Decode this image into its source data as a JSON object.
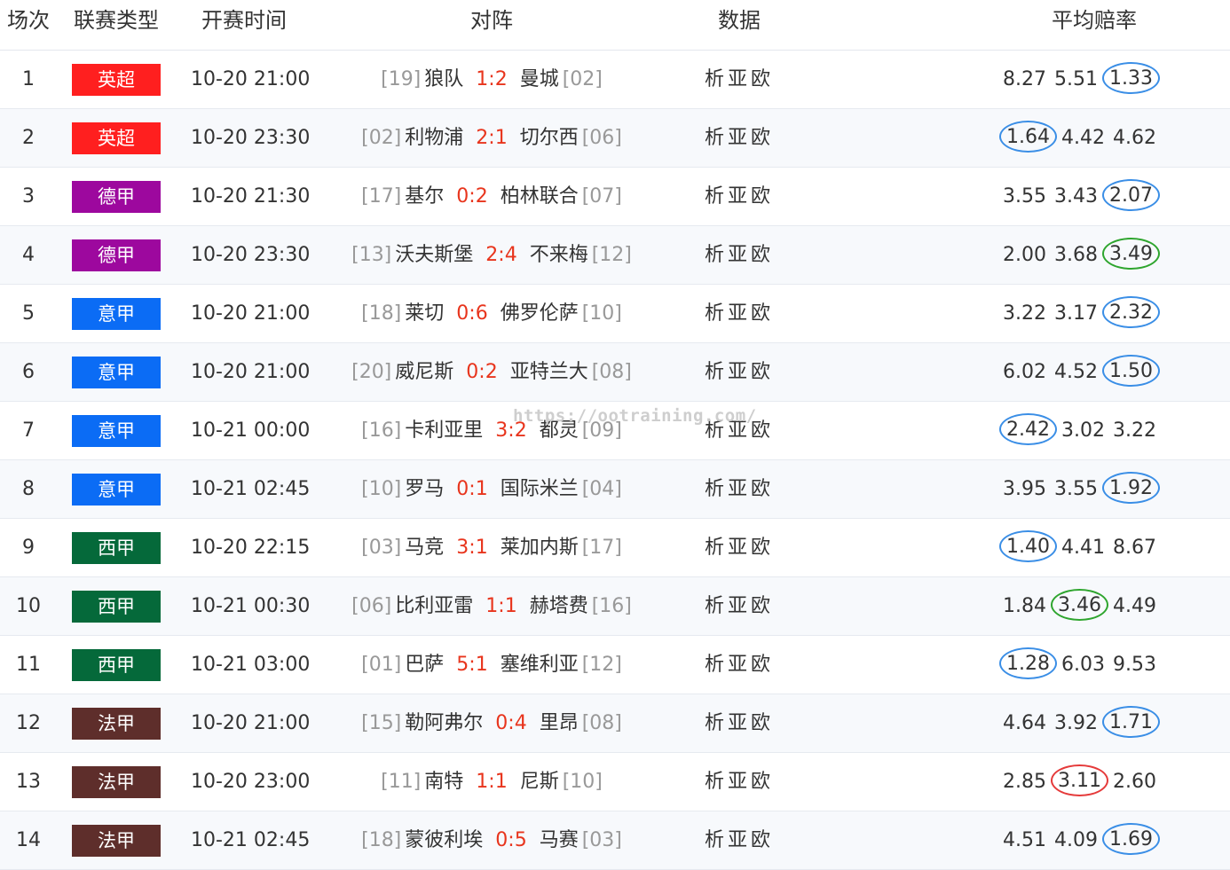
{
  "header": {
    "col_num": "场次",
    "col_league": "联赛类型",
    "col_time": "开赛时间",
    "col_match": "对阵",
    "col_data": "数据",
    "col_odds": "平均赔率"
  },
  "colors": {
    "premier_league": "#ff1f1f",
    "bundesliga": "#9d089e",
    "serie_a": "#0b6cf5",
    "la_liga": "#05693a",
    "ligue_1": "#5e2e2b",
    "score_red": "#e8351d",
    "circle_blue": "#3a8ee6",
    "circle_green": "#2ea52e",
    "circle_red": "#e53a3a"
  },
  "data_links": [
    "析",
    "亚",
    "欧"
  ],
  "watermark": "https://ootraining.com/",
  "rows": [
    {
      "num": "1",
      "league": "英超",
      "league_color": "#ff1f1f",
      "time": "10-20 21:00",
      "home_rank": "[19]",
      "home": "狼队",
      "score": "1:2",
      "away": "曼城",
      "away_rank": "[02]",
      "odds": [
        "8.27",
        "5.51",
        "1.33"
      ],
      "circled": 2,
      "circle_color": "#3a8ee6"
    },
    {
      "num": "2",
      "league": "英超",
      "league_color": "#ff1f1f",
      "time": "10-20 23:30",
      "home_rank": "[02]",
      "home": "利物浦",
      "score": "2:1",
      "away": "切尔西",
      "away_rank": "[06]",
      "odds": [
        "1.64",
        "4.42",
        "4.62"
      ],
      "circled": 0,
      "circle_color": "#3a8ee6"
    },
    {
      "num": "3",
      "league": "德甲",
      "league_color": "#9d089e",
      "time": "10-20 21:30",
      "home_rank": "[17]",
      "home": "基尔",
      "score": "0:2",
      "away": "柏林联合",
      "away_rank": "[07]",
      "odds": [
        "3.55",
        "3.43",
        "2.07"
      ],
      "circled": 2,
      "circle_color": "#3a8ee6"
    },
    {
      "num": "4",
      "league": "德甲",
      "league_color": "#9d089e",
      "time": "10-20 23:30",
      "home_rank": "[13]",
      "home": "沃夫斯堡",
      "score": "2:4",
      "away": "不来梅",
      "away_rank": "[12]",
      "odds": [
        "2.00",
        "3.68",
        "3.49"
      ],
      "circled": 2,
      "circle_color": "#2ea52e"
    },
    {
      "num": "5",
      "league": "意甲",
      "league_color": "#0b6cf5",
      "time": "10-20 21:00",
      "home_rank": "[18]",
      "home": "莱切",
      "score": "0:6",
      "away": "佛罗伦萨",
      "away_rank": "[10]",
      "odds": [
        "3.22",
        "3.17",
        "2.32"
      ],
      "circled": 2,
      "circle_color": "#3a8ee6"
    },
    {
      "num": "6",
      "league": "意甲",
      "league_color": "#0b6cf5",
      "time": "10-20 21:00",
      "home_rank": "[20]",
      "home": "威尼斯",
      "score": "0:2",
      "away": "亚特兰大",
      "away_rank": "[08]",
      "odds": [
        "6.02",
        "4.52",
        "1.50"
      ],
      "circled": 2,
      "circle_color": "#3a8ee6"
    },
    {
      "num": "7",
      "league": "意甲",
      "league_color": "#0b6cf5",
      "time": "10-21 00:00",
      "home_rank": "[16]",
      "home": "卡利亚里",
      "score": "3:2",
      "away": "都灵",
      "away_rank": "[09]",
      "odds": [
        "2.42",
        "3.02",
        "3.22"
      ],
      "circled": 0,
      "circle_color": "#3a8ee6"
    },
    {
      "num": "8",
      "league": "意甲",
      "league_color": "#0b6cf5",
      "time": "10-21 02:45",
      "home_rank": "[10]",
      "home": "罗马",
      "score": "0:1",
      "away": "国际米兰",
      "away_rank": "[04]",
      "odds": [
        "3.95",
        "3.55",
        "1.92"
      ],
      "circled": 2,
      "circle_color": "#3a8ee6"
    },
    {
      "num": "9",
      "league": "西甲",
      "league_color": "#05693a",
      "time": "10-20 22:15",
      "home_rank": "[03]",
      "home": "马竞",
      "score": "3:1",
      "away": "莱加内斯",
      "away_rank": "[17]",
      "odds": [
        "1.40",
        "4.41",
        "8.67"
      ],
      "circled": 0,
      "circle_color": "#3a8ee6"
    },
    {
      "num": "10",
      "league": "西甲",
      "league_color": "#05693a",
      "time": "10-21 00:30",
      "home_rank": "[06]",
      "home": "比利亚雷",
      "score": "1:1",
      "away": "赫塔费",
      "away_rank": "[16]",
      "odds": [
        "1.84",
        "3.46",
        "4.49"
      ],
      "circled": 1,
      "circle_color": "#2ea52e"
    },
    {
      "num": "11",
      "league": "西甲",
      "league_color": "#05693a",
      "time": "10-21 03:00",
      "home_rank": "[01]",
      "home": "巴萨",
      "score": "5:1",
      "away": "塞维利亚",
      "away_rank": "[12]",
      "odds": [
        "1.28",
        "6.03",
        "9.53"
      ],
      "circled": 0,
      "circle_color": "#3a8ee6"
    },
    {
      "num": "12",
      "league": "法甲",
      "league_color": "#5e2e2b",
      "time": "10-20 21:00",
      "home_rank": "[15]",
      "home": "勒阿弗尔",
      "score": "0:4",
      "away": "里昂",
      "away_rank": "[08]",
      "odds": [
        "4.64",
        "3.92",
        "1.71"
      ],
      "circled": 2,
      "circle_color": "#3a8ee6"
    },
    {
      "num": "13",
      "league": "法甲",
      "league_color": "#5e2e2b",
      "time": "10-20 23:00",
      "home_rank": "[11]",
      "home": "南特",
      "score": "1:1",
      "away": "尼斯",
      "away_rank": "[10]",
      "odds": [
        "2.85",
        "3.11",
        "2.60"
      ],
      "circled": 1,
      "circle_color": "#e53a3a"
    },
    {
      "num": "14",
      "league": "法甲",
      "league_color": "#5e2e2b",
      "time": "10-21 02:45",
      "home_rank": "[18]",
      "home": "蒙彼利埃",
      "score": "0:5",
      "away": "马赛",
      "away_rank": "[03]",
      "odds": [
        "4.51",
        "4.09",
        "1.69"
      ],
      "circled": 2,
      "circle_color": "#3a8ee6"
    }
  ]
}
